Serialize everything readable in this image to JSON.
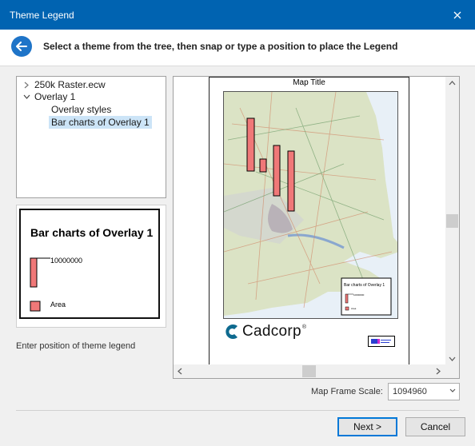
{
  "window": {
    "title": "Theme Legend"
  },
  "header": {
    "instruction": "Select a theme from the tree, then snap or type a position to place the Legend"
  },
  "tree": {
    "items": [
      {
        "label": "250k Raster.ecw",
        "expanded": false
      },
      {
        "label": "Overlay 1",
        "expanded": true
      },
      {
        "label": "Overlay styles"
      },
      {
        "label": "Bar charts of Overlay 1",
        "selected": true
      }
    ]
  },
  "legend": {
    "title": "Bar charts of Overlay 1",
    "bar_value": "10000000",
    "area_label": "Area",
    "bar_color": "#f07878"
  },
  "hint": "Enter position of theme legend",
  "preview": {
    "map_title": "Map Title",
    "logo_text": "Cadcorp",
    "logo_mark": "®",
    "mini_legend": {
      "title": "Bar charts of Overlay 1",
      "bar_value": "10000000",
      "area_label": "Area"
    }
  },
  "scale": {
    "label": "Map Frame Scale:",
    "value": "1094960"
  },
  "buttons": {
    "next": "Next >",
    "cancel": "Cancel"
  },
  "colors": {
    "accent": "#0063b1",
    "selection": "#cce4f7",
    "bar": "#f07878"
  }
}
